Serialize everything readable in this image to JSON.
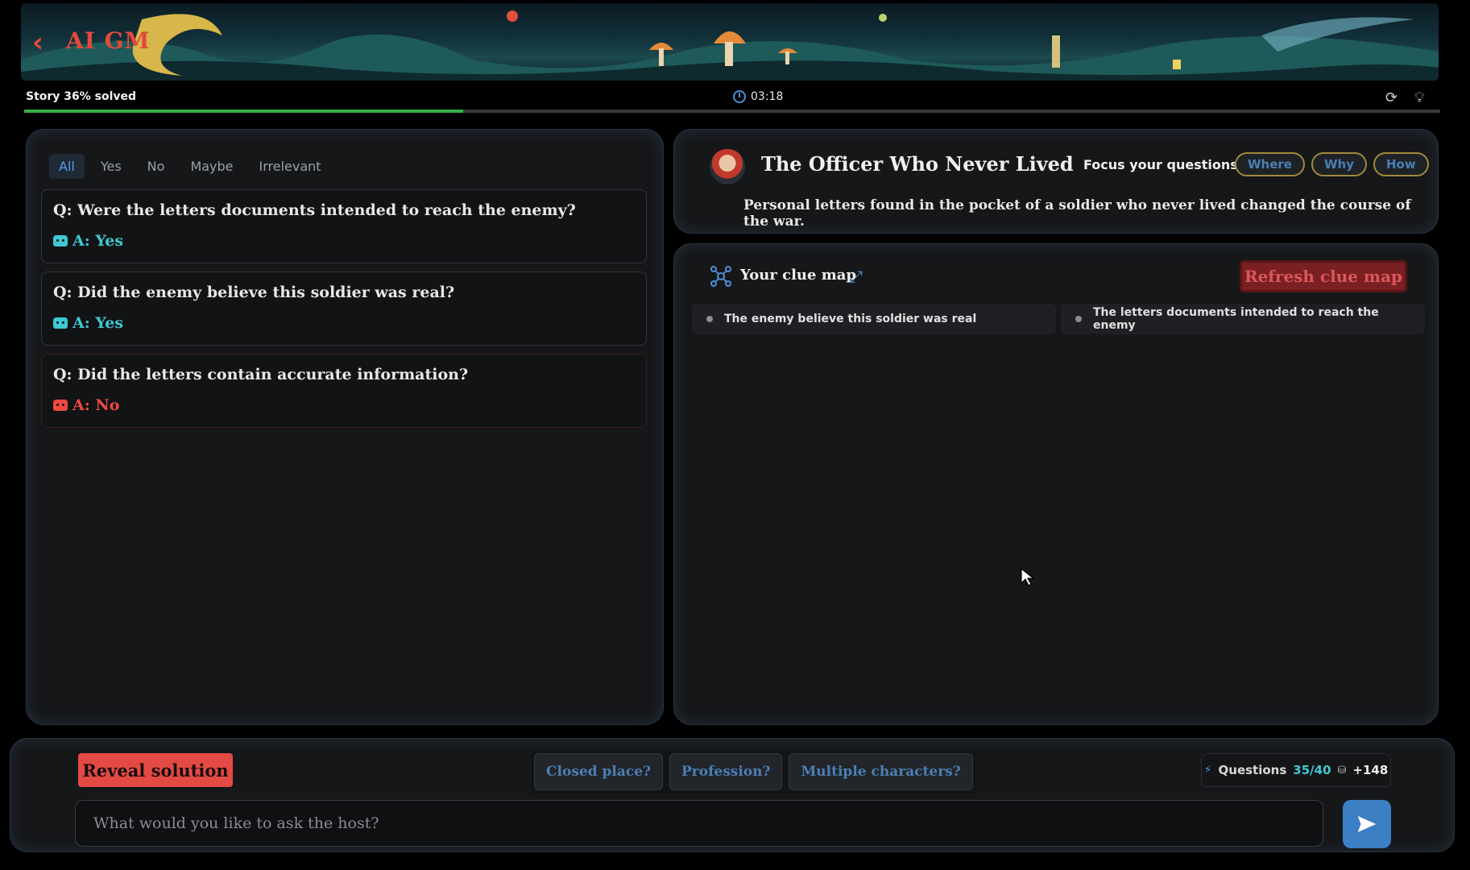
{
  "header": {
    "title": "AI GM",
    "back_icon": "chevron-left-icon",
    "colors": {
      "title": "#e24a3c"
    }
  },
  "status": {
    "progress_label": "Story 36% solved",
    "progress_value": 0.31,
    "timer": "03:18",
    "timer_icon": "clock-icon",
    "refresh_icon": "refresh-icon",
    "hint_icon": "lightbulb-icon",
    "progress_color": "#35b04a"
  },
  "filters": {
    "tabs": [
      {
        "label": "All",
        "active": true
      },
      {
        "label": "Yes"
      },
      {
        "label": "No"
      },
      {
        "label": "Maybe"
      },
      {
        "label": "Irrelevant"
      }
    ]
  },
  "qa": [
    {
      "question": "Q: Were the letters documents intended to reach the enemy?",
      "answer": "A: Yes",
      "type": "yes"
    },
    {
      "question": "Q: Did the enemy believe this soldier was real?",
      "answer": "A: Yes",
      "type": "yes"
    },
    {
      "question": "Q: Did the letters contain accurate information?",
      "answer": "A: No",
      "type": "no"
    }
  ],
  "story": {
    "title": "The Officer Who Never Lived",
    "focus_label": "Focus your questions on:",
    "focus_chips": [
      "Where",
      "Why",
      "How"
    ],
    "description": "Personal letters found in the pocket of a soldier who never lived changed the course of the war."
  },
  "clue_map": {
    "title": "Your clue map",
    "refresh_label": "Refresh clue map",
    "items": [
      "The enemy believe this soldier was real",
      "The letters documents intended to reach the enemy"
    ]
  },
  "bottom": {
    "reveal_label": "Reveal solution",
    "suggestions": [
      "Closed place?",
      "Profession?",
      "Multiple characters?"
    ],
    "questions_label": "Questions",
    "questions_count": "35/40",
    "bonus": "+148",
    "input_placeholder": "What would you like to ask the host?"
  }
}
